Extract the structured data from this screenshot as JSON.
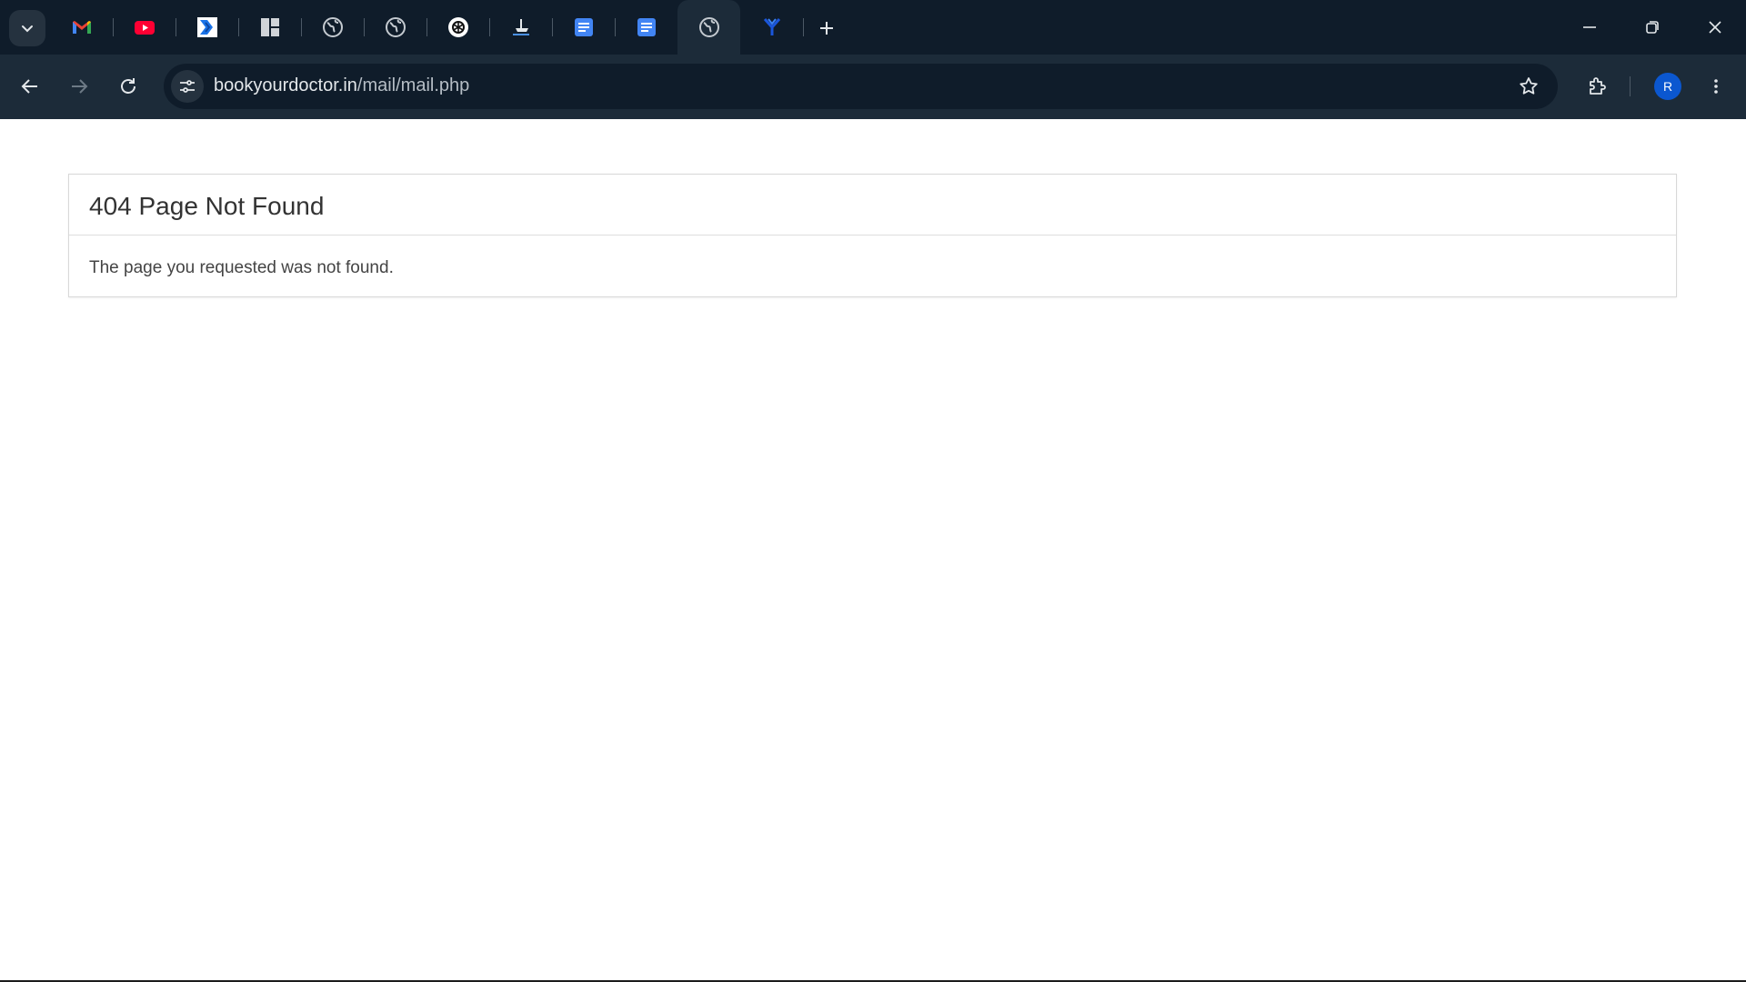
{
  "browser": {
    "tabs": [
      {
        "icon": "gmail-icon"
      },
      {
        "icon": "youtube-icon"
      },
      {
        "icon": "dashboard-arrow-icon"
      },
      {
        "icon": "grid-layout-icon"
      },
      {
        "icon": "globe-icon"
      },
      {
        "icon": "globe-icon"
      },
      {
        "icon": "openai-icon"
      },
      {
        "icon": "ship-icon"
      },
      {
        "icon": "docs-icon"
      },
      {
        "icon": "docs-icon"
      },
      {
        "icon": "globe-icon",
        "active": true
      },
      {
        "icon": "y-logo-icon"
      }
    ],
    "address": {
      "domain": "bookyourdoctor.in",
      "path": "/mail/mail.php"
    },
    "profile_initial": "R"
  },
  "page": {
    "title": "404 Page Not Found",
    "message": "The page you requested was not found."
  },
  "colors": {
    "chrome_dark": "#0f1c2a",
    "toolbar": "#1c2b39",
    "avatar": "#0b57d0"
  }
}
